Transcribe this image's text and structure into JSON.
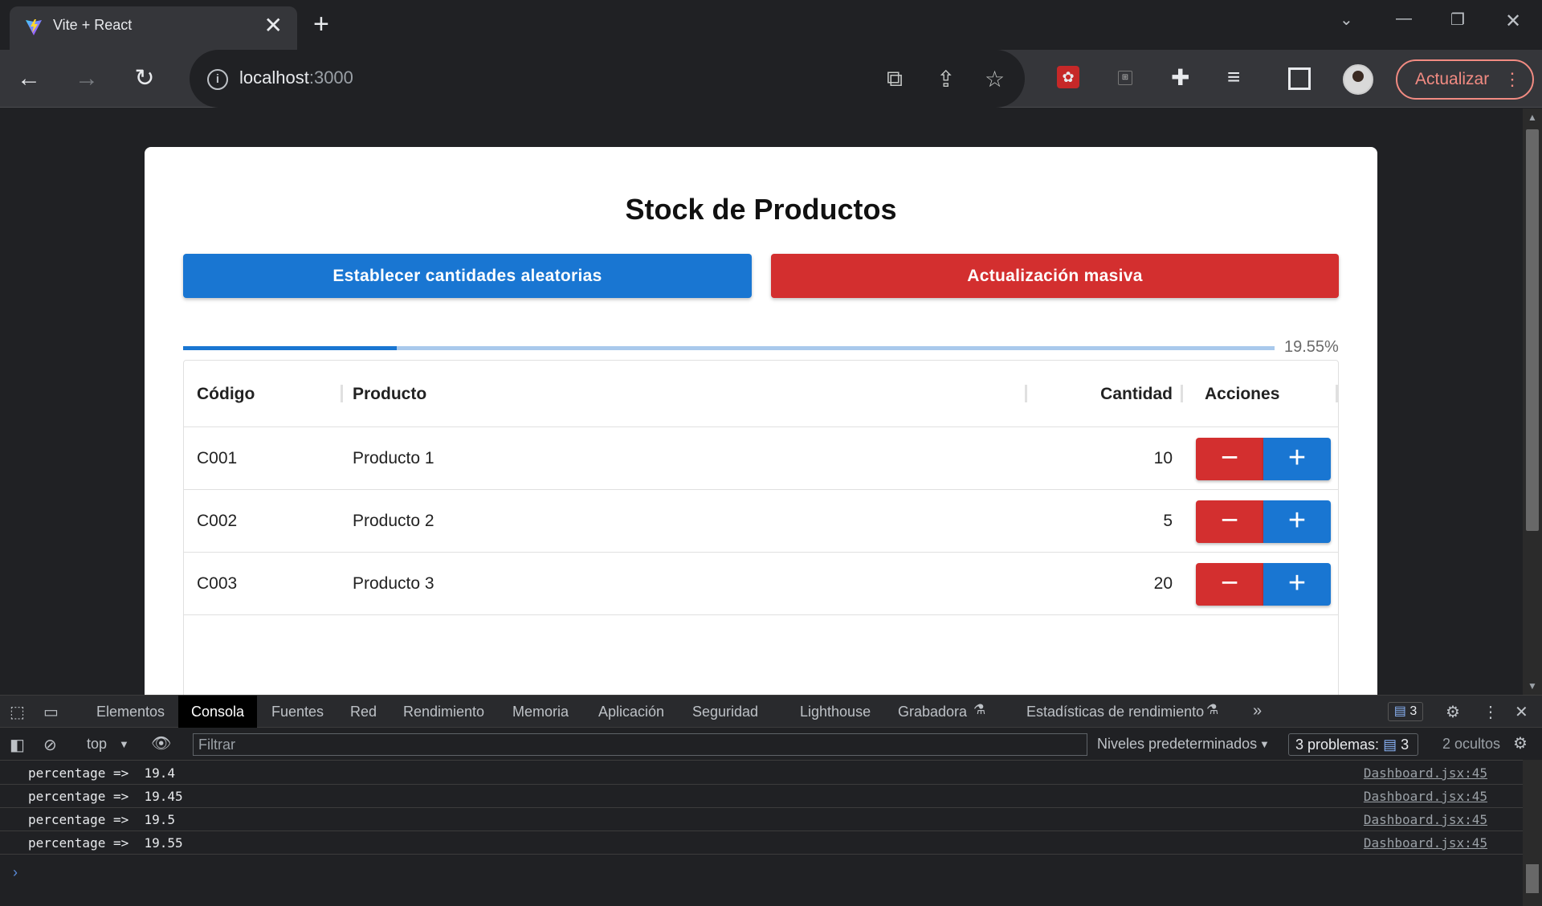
{
  "browser": {
    "tab_title": "Vite + React",
    "tab_close": "✕",
    "new_tab": "+",
    "url_host": "localhost",
    "url_port": ":3000",
    "update_label": "Actualizar",
    "update_menu": "⋮"
  },
  "page": {
    "title": "Stock de Productos",
    "btn_random": "Establecer cantidades aleatorias",
    "btn_bulk": "Actualización masiva",
    "progress_percent": 19.55,
    "progress_label": "19.55%",
    "colors": {
      "primary": "#1976d2",
      "danger": "#d32f2f"
    },
    "table": {
      "headers": {
        "code": "Código",
        "product": "Producto",
        "qty": "Cantidad",
        "actions": "Acciones"
      },
      "rows": [
        {
          "code": "C001",
          "product": "Producto 1",
          "qty": "10"
        },
        {
          "code": "C002",
          "product": "Producto 2",
          "qty": "5"
        },
        {
          "code": "C003",
          "product": "Producto 3",
          "qty": "20"
        }
      ],
      "minus": "−",
      "plus": "+"
    }
  },
  "devtools": {
    "tabs": [
      "Elementos",
      "Consola",
      "Fuentes",
      "Red",
      "Rendimiento",
      "Memoria",
      "Aplicación",
      "Seguridad",
      "Lighthouse",
      "Grabadora",
      "Estadísticas de rendimiento"
    ],
    "issues_count": "3",
    "context": "top",
    "filter_placeholder": "Filtrar",
    "levels": "Niveles predeterminados",
    "problems": "3 problemas:",
    "problems_count": "3",
    "hidden": "2 ocultos",
    "console": [
      {
        "text": "percentage =>  19.4",
        "source": "Dashboard.jsx:45"
      },
      {
        "text": "percentage =>  19.45",
        "source": "Dashboard.jsx:45"
      },
      {
        "text": "percentage =>  19.5",
        "source": "Dashboard.jsx:45"
      },
      {
        "text": "percentage =>  19.55",
        "source": "Dashboard.jsx:45"
      }
    ]
  }
}
